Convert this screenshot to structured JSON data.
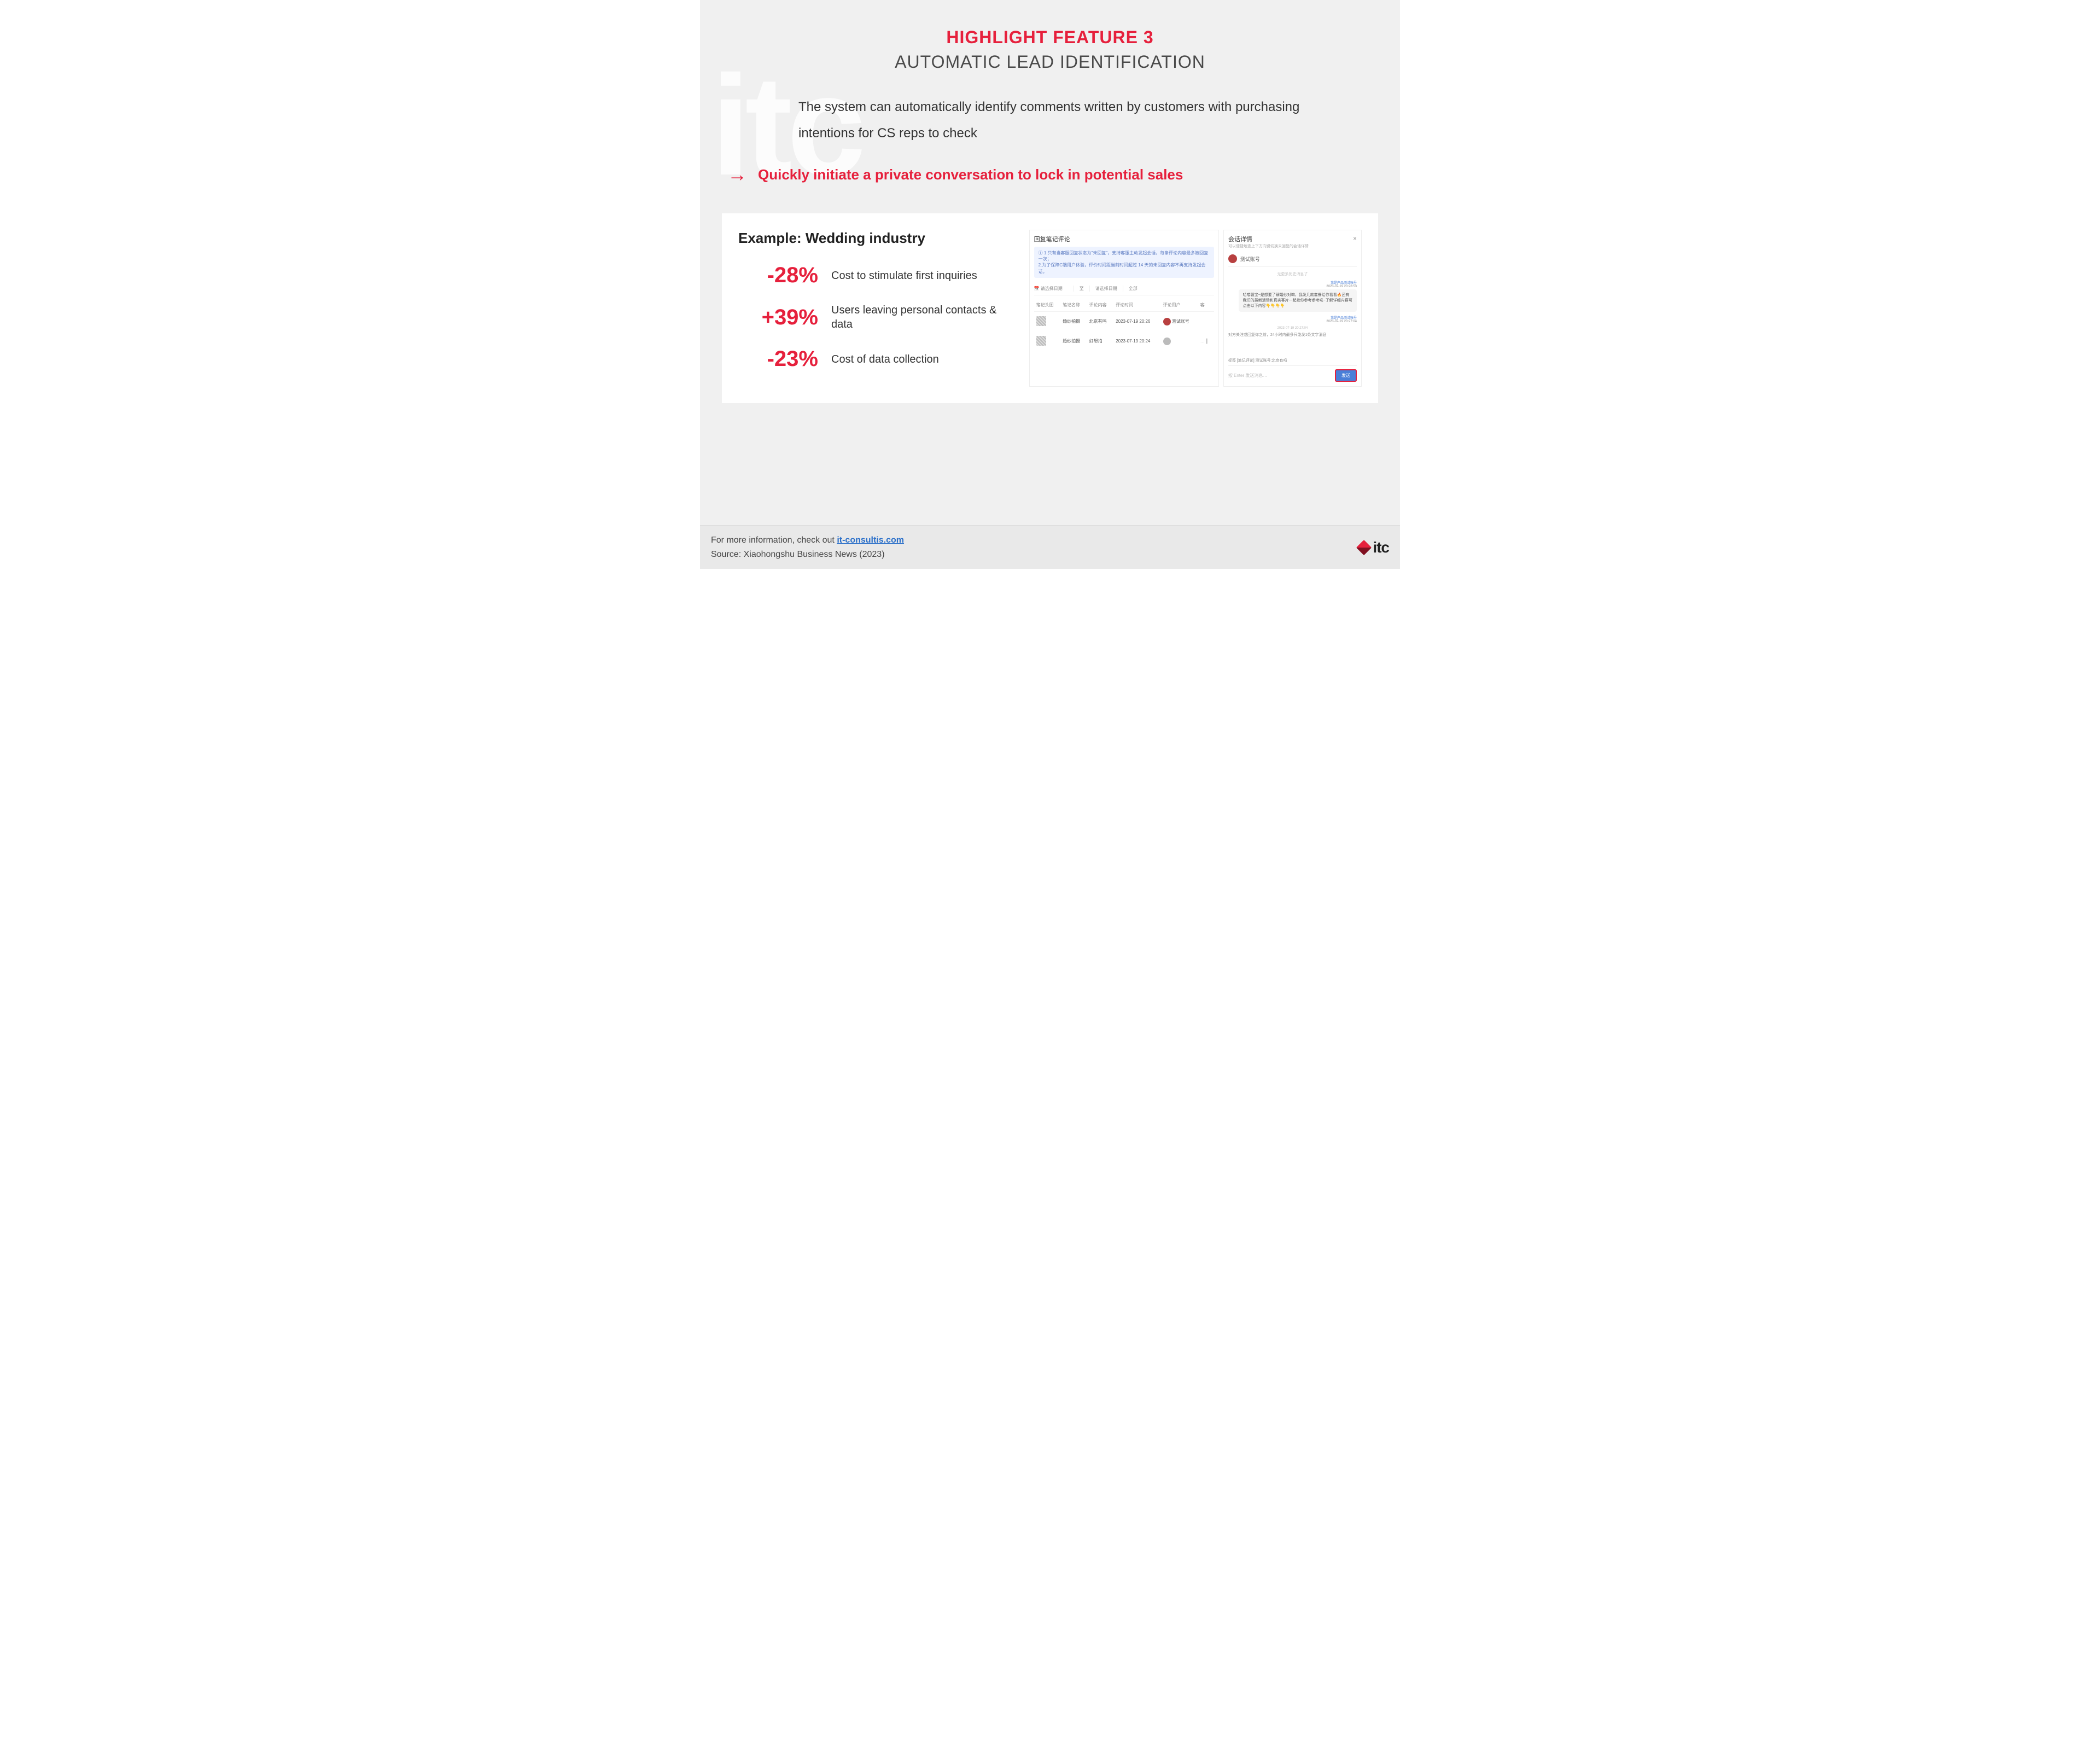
{
  "watermark": "itc",
  "header": {
    "title": "HIGHLIGHT FEATURE 3",
    "subtitle": "AUTOMATIC LEAD IDENTIFICATION"
  },
  "description": "The system can automatically identify comments written by customers with purchasing intentions for CS reps to check",
  "callout": "Quickly initiate a private conversation to lock in potential sales",
  "example": {
    "title": "Example: Wedding industry",
    "stats": [
      {
        "value": "-28%",
        "label": "Cost to stimulate first inquiries"
      },
      {
        "value": "+39%",
        "label": "Users leaving personal contacts & data"
      },
      {
        "value": "-23%",
        "label": "Cost of data collection"
      }
    ]
  },
  "mock": {
    "table": {
      "title": "回复笔记评论",
      "info_line1": "1.只有当客服回复状态为\"未回复\"，支持客服主动发起会话，每条评论内容最多被回复一次；",
      "info_line2": "2.为了保障C端用户体验，评价时间距当前时间超过 14 天的未回复内容不再支持发起会话。",
      "filter_date1": "请选择日期",
      "filter_sep": "至",
      "filter_date2": "请选择日期",
      "filter_all": "全部",
      "headers": {
        "c1": "笔记头图",
        "c2": "笔记名称",
        "c3": "评论内容",
        "c4": "评论时间",
        "c5": "评论用户",
        "c6": "客"
      },
      "rows": [
        {
          "name": "婚纱拍摄",
          "content": "北京有吗",
          "time": "2023-07-19 20:26",
          "user": "测试账号"
        },
        {
          "name": "婚纱拍摄",
          "content": "好想拍",
          "time": "2023-07-19 20:24",
          "user": ""
        }
      ]
    },
    "chat": {
      "title": "会话详情",
      "subtitle": "可以便捷地查上下方向键切换未回复的会话详情",
      "user": "测试账号",
      "no_result": "无更多历史消息了",
      "meta_name": "我是产品测试账号",
      "meta_ts1": "2023-07-19 20:26:53",
      "bubble1": "哈喽薯宝~是想要了解婚纱对嘛，我发几款套餐给你看看🔥还有我们的最新活动和真实客片一起发你参考参考哎~了解详细内容可点击以下内容👇👇👇👇",
      "meta_ts2": "2023-07-19 20:27:04",
      "ts_center": "2023-07-19 20:27:04",
      "note": "对方关注或回复你之前，24小时内最多只能发1条文字消息",
      "tags": "标签 [笔记评论] 测试账号:北京有吗",
      "placeholder": "按 Enter 发送消息…",
      "send": "发送"
    }
  },
  "footer": {
    "info_prefix": "For more information, check out ",
    "link": "it-consultis.com",
    "source": "Source:  Xiaohongshu Business News (2023)",
    "logo": "itc"
  }
}
